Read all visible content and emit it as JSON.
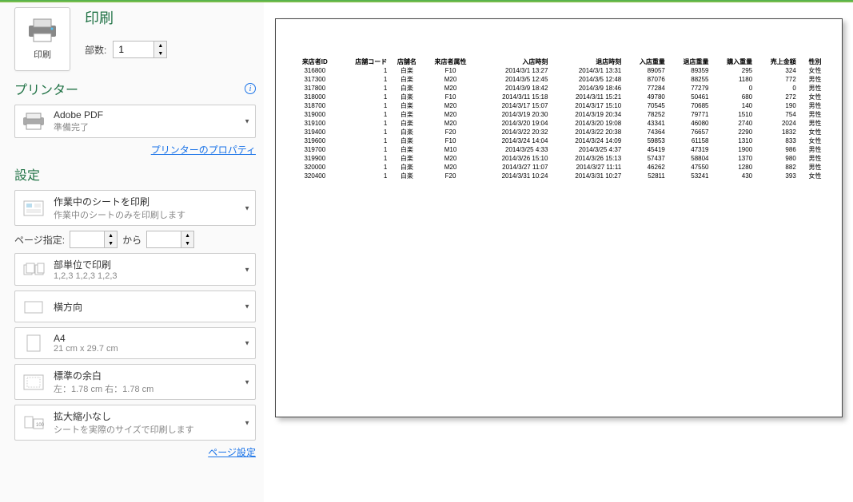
{
  "print": {
    "title": "印刷",
    "button_label": "印刷",
    "copies_label": "部数:",
    "copies_value": "1"
  },
  "printer": {
    "section_title": "プリンター",
    "name": "Adobe PDF",
    "status": "準備完了",
    "properties_link": "プリンターのプロパティ"
  },
  "settings": {
    "section_title": "設定",
    "sheet": {
      "title": "作業中のシートを印刷",
      "sub": "作業中のシートのみを印刷します"
    },
    "page_label": "ページ指定:",
    "page_from": "",
    "page_sep": "から",
    "page_to": "",
    "collate": {
      "title": "部単位で印刷",
      "sub": "1,2,3    1,2,3    1,2,3"
    },
    "orientation": {
      "title": "横方向"
    },
    "paper": {
      "title": "A4",
      "sub": "21 cm x 29.7 cm"
    },
    "margin": {
      "title": "標準の余白",
      "sub": "左：1.78 cm   右：1.78 cm"
    },
    "scale": {
      "title": "拡大縮小なし",
      "sub": "シートを実際のサイズで印刷します"
    },
    "page_setup_link": "ページ設定"
  },
  "table": {
    "headers": [
      "来店者ID",
      "店舗コード",
      "店舗名",
      "来店者属性",
      "入店時刻",
      "退店時刻",
      "入店重量",
      "退店重量",
      "購入重量",
      "売上金額",
      "性別"
    ],
    "rows": [
      [
        "316800",
        "1",
        "白楽",
        "F10",
        "2014/3/1 13:27",
        "2014/3/1 13:31",
        "89057",
        "89359",
        "295",
        "324",
        "女性"
      ],
      [
        "317300",
        "1",
        "白楽",
        "M20",
        "2014/3/5 12:45",
        "2014/3/5 12:48",
        "87076",
        "88255",
        "1180",
        "772",
        "男性"
      ],
      [
        "317800",
        "1",
        "白楽",
        "M20",
        "2014/3/9 18:42",
        "2014/3/9 18:46",
        "77284",
        "77279",
        "0",
        "0",
        "男性"
      ],
      [
        "318000",
        "1",
        "白楽",
        "F10",
        "2014/3/11 15:18",
        "2014/3/11 15:21",
        "49780",
        "50461",
        "680",
        "272",
        "女性"
      ],
      [
        "318700",
        "1",
        "白楽",
        "M20",
        "2014/3/17 15:07",
        "2014/3/17 15:10",
        "70545",
        "70685",
        "140",
        "190",
        "男性"
      ],
      [
        "319000",
        "1",
        "白楽",
        "M20",
        "2014/3/19 20:30",
        "2014/3/19 20:34",
        "78252",
        "79771",
        "1510",
        "754",
        "男性"
      ],
      [
        "319100",
        "1",
        "白楽",
        "M20",
        "2014/3/20 19:04",
        "2014/3/20 19:08",
        "43341",
        "46080",
        "2740",
        "2024",
        "男性"
      ],
      [
        "319400",
        "1",
        "白楽",
        "F20",
        "2014/3/22 20:32",
        "2014/3/22 20:38",
        "74364",
        "76657",
        "2290",
        "1832",
        "女性"
      ],
      [
        "319600",
        "1",
        "白楽",
        "F10",
        "2014/3/24 14:04",
        "2014/3/24 14:09",
        "59853",
        "61158",
        "1310",
        "833",
        "女性"
      ],
      [
        "319700",
        "1",
        "白楽",
        "M10",
        "2014/3/25 4:33",
        "2014/3/25 4:37",
        "45419",
        "47319",
        "1900",
        "986",
        "男性"
      ],
      [
        "319900",
        "1",
        "白楽",
        "M20",
        "2014/3/26 15:10",
        "2014/3/26 15:13",
        "57437",
        "58804",
        "1370",
        "980",
        "男性"
      ],
      [
        "320000",
        "1",
        "白楽",
        "M20",
        "2014/3/27 11:07",
        "2014/3/27 11:11",
        "46262",
        "47550",
        "1280",
        "882",
        "男性"
      ],
      [
        "320400",
        "1",
        "白楽",
        "F20",
        "2014/3/31 10:24",
        "2014/3/31 10:27",
        "52811",
        "53241",
        "430",
        "393",
        "女性"
      ]
    ]
  }
}
